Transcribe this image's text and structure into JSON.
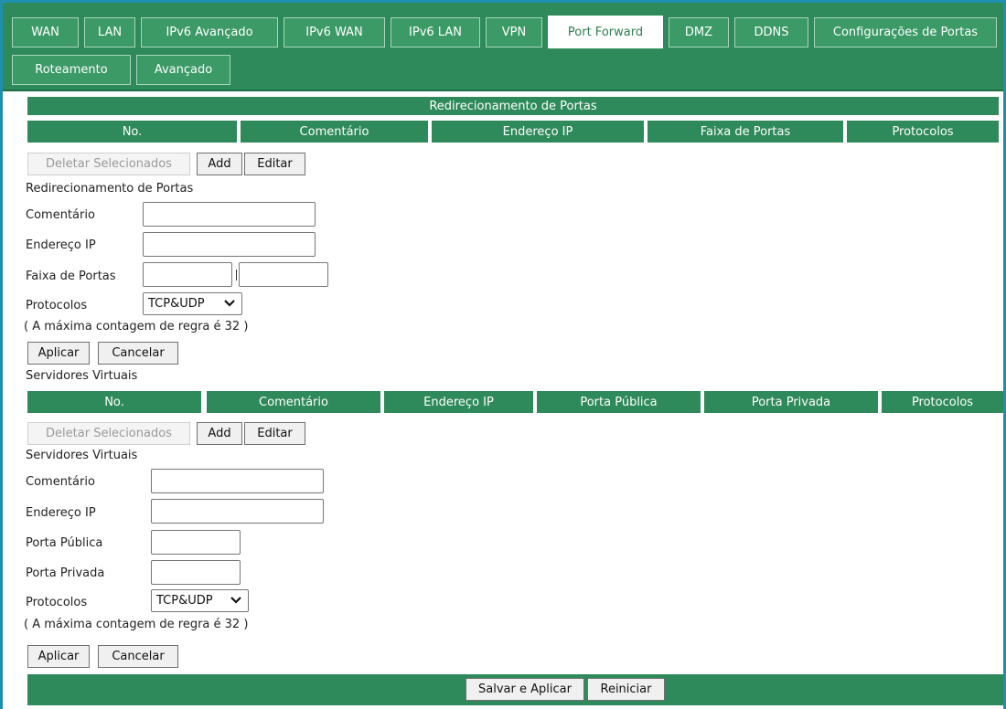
{
  "tabs": {
    "row1": [
      "WAN",
      "LAN",
      "IPv6 Avançado",
      "IPv6 WAN",
      "IPv6 LAN",
      "VPN",
      "Port Forward",
      "DMZ",
      "DDNS",
      "Configurações de Portas"
    ],
    "row2": [
      "Roteamento",
      "Avançado"
    ],
    "active": "Port Forward"
  },
  "port_forward": {
    "table_title": "Redirecionamento de Portas",
    "columns": [
      "No.",
      "Comentário",
      "Endereço IP",
      "Faixa de Portas",
      "Protocolos"
    ],
    "delete_label": "Deletar Selecionados",
    "add_label": "Add",
    "edit_label": "Editar",
    "form_title": "Redirecionamento de Portas",
    "comment_label": "Comentário",
    "comment_value": "",
    "ip_label": "Endereço IP",
    "ip_value": "",
    "range_label": "Faixa de Portas",
    "range_start_value": "",
    "range_end_value": "",
    "protocol_label": "Protocolos",
    "protocol_value": "TCP&UDP",
    "max_rules_note": "( A máxima contagem de regra é 32 )",
    "apply_label": "Aplicar",
    "cancel_label": "Cancelar"
  },
  "virtual_servers": {
    "section_title": "Servidores Virtuais",
    "columns": [
      "No.",
      "Comentário",
      "Endereço IP",
      "Porta Pública",
      "Porta Privada",
      "Protocolos"
    ],
    "delete_label": "Deletar Selecionados",
    "add_label": "Add",
    "edit_label": "Editar",
    "form_title": "Servidores Virtuais",
    "comment_label": "Comentário",
    "comment_value": "",
    "ip_label": "Endereço IP",
    "ip_value": "",
    "public_port_label": "Porta Pública",
    "public_port_value": "",
    "private_port_label": "Porta Privada",
    "private_port_value": "",
    "protocol_label": "Protocolos",
    "protocol_value": "TCP&UDP",
    "max_rules_note": "( A máxima contagem de regra é 32 )",
    "apply_label": "Aplicar",
    "cancel_label": "Cancelar"
  },
  "footer": {
    "save_apply_label": "Salvar e Aplicar",
    "restart_label": "Reiniciar"
  },
  "colors": {
    "header_green": "#2e8a5a",
    "frame_blue": "#1f8fb0",
    "tab_green": "#3b9a66"
  }
}
